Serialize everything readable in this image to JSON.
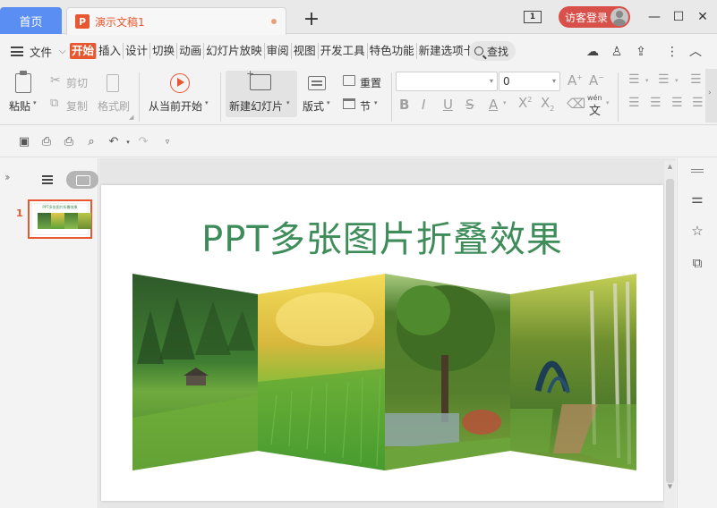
{
  "titlebar": {
    "home_tab": "首页",
    "doc_logo": "P",
    "doc_tab": "演示文稿1",
    "new_tab": "+",
    "window_counter": "1",
    "login": "访客登录",
    "minimize": "—",
    "maximize": "☐",
    "close": "✕"
  },
  "menubar": {
    "file": "文件",
    "items": [
      "开始",
      "插入",
      "设计",
      "切换",
      "动画",
      "幻灯片放映",
      "审阅",
      "视图",
      "开发工具",
      "特色功能",
      "新建选项卡"
    ],
    "active_index": 0,
    "search": "查找"
  },
  "ribbon": {
    "paste": "粘贴",
    "cut": "剪切",
    "copy": "复制",
    "format_painter": "格式刷",
    "from_current": "从当前开始",
    "new_slide": "新建幻灯片",
    "layout": "版式",
    "reset": "重置",
    "section": "节",
    "font_name": "",
    "font_size": "0",
    "phonetic": "wén"
  },
  "slide": {
    "number": "1",
    "title": "PPT多张图片折叠效果"
  },
  "colors": {
    "accent": "#e8572f",
    "home_tab": "#5b8ef2",
    "title_green": "#3e8c5a",
    "login_red": "#d8504a"
  }
}
